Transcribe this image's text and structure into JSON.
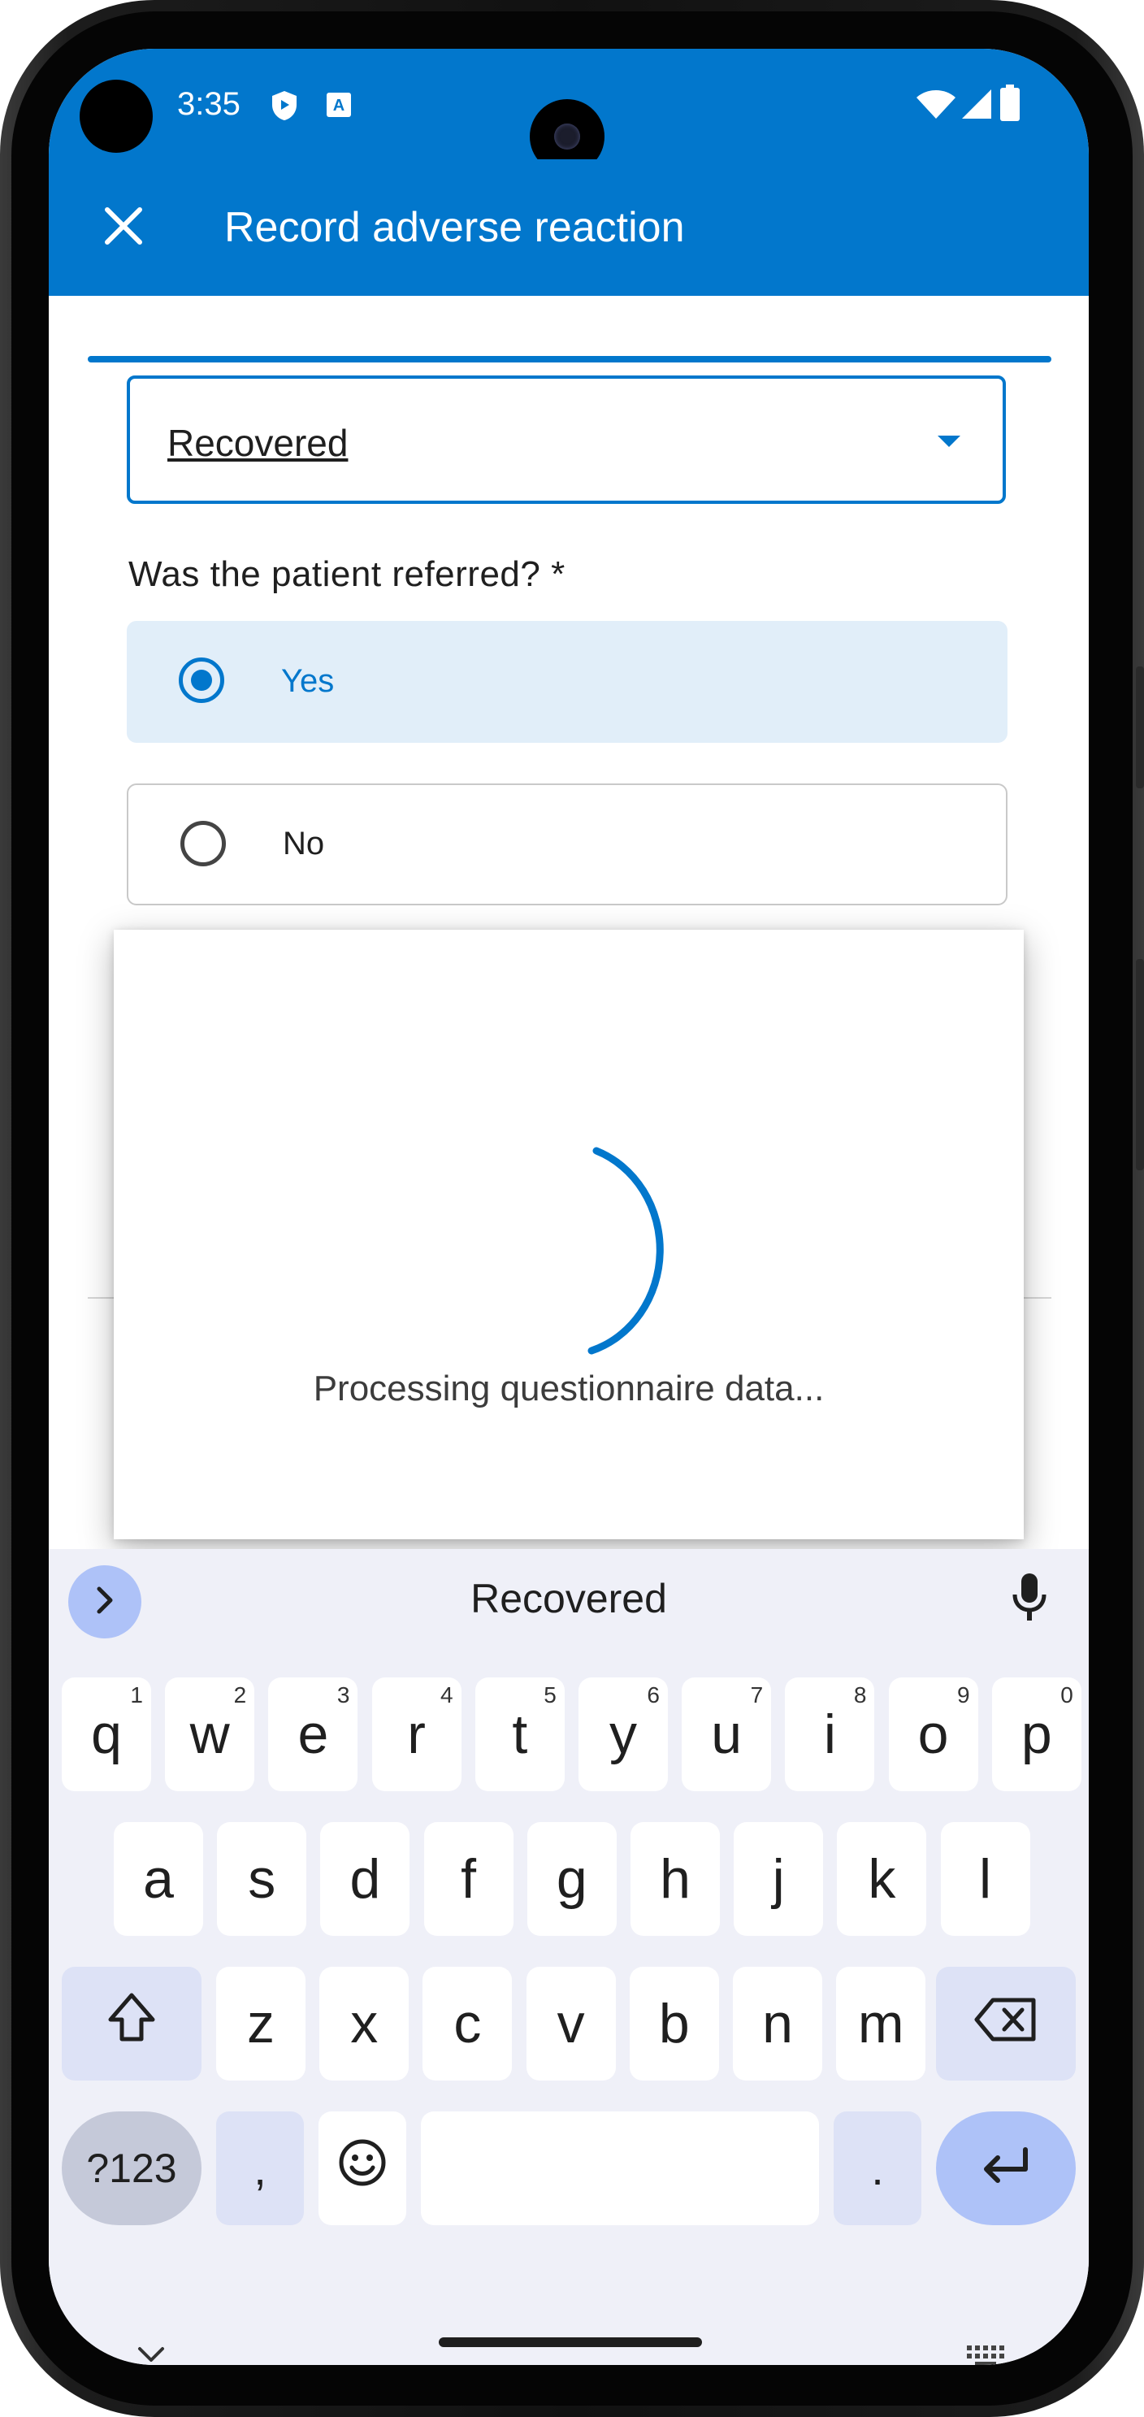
{
  "status_bar": {
    "time": "3:35",
    "icons": [
      "shield-icon",
      "translate-icon",
      "wifi-icon",
      "signal-icon",
      "battery-icon"
    ]
  },
  "app_bar": {
    "title": "Record adverse reaction",
    "close_icon": "close-icon"
  },
  "form": {
    "outcome_dropdown": {
      "value": "Recovered"
    },
    "referral_question": "Was the patient referred? *",
    "options": [
      {
        "label": "Yes",
        "selected": true
      },
      {
        "label": "No",
        "selected": false
      }
    ]
  },
  "dialog": {
    "message": "Processing questionnaire data..."
  },
  "keyboard": {
    "suggestion": "Recovered",
    "row1": [
      {
        "key": "q",
        "hint": "1"
      },
      {
        "key": "w",
        "hint": "2"
      },
      {
        "key": "e",
        "hint": "3"
      },
      {
        "key": "r",
        "hint": "4"
      },
      {
        "key": "t",
        "hint": "5"
      },
      {
        "key": "y",
        "hint": "6"
      },
      {
        "key": "u",
        "hint": "7"
      },
      {
        "key": "i",
        "hint": "8"
      },
      {
        "key": "o",
        "hint": "9"
      },
      {
        "key": "p",
        "hint": "0"
      }
    ],
    "row2": [
      "a",
      "s",
      "d",
      "f",
      "g",
      "h",
      "j",
      "k",
      "l"
    ],
    "row3": [
      "z",
      "x",
      "c",
      "v",
      "b",
      "n",
      "m"
    ],
    "symbols_label": "?123",
    "comma_label": ",",
    "period_label": "."
  },
  "colors": {
    "primary": "#0277cc",
    "selected_option_bg": "#e1eef9",
    "keyboard_bg": "#eff0f8",
    "modifier_key": "#dde2f6",
    "enter_key": "#aec2f8"
  }
}
